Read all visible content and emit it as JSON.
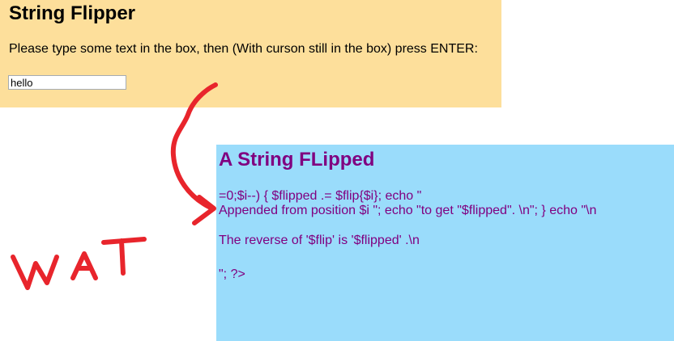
{
  "header": {
    "title": "String Flipper",
    "instructions": "Please type some text in the box, then (With curson still in the box) press ENTER:"
  },
  "input": {
    "value": "hello"
  },
  "result": {
    "title": "A String FLipped",
    "lines": [
      "=0;$i--) { $flipped .= $flip{$i}; echo \"",
      "Appended from position $i \"; echo \"to get \"$flipped\". \\n\"; } echo \"\\n",
      "The reverse of '$flip' is '$flipped' .\\n",
      "\"; ?>"
    ]
  },
  "annotation": {
    "text": "WAT",
    "color": "#e8252c"
  },
  "colors": {
    "top_panel_bg": "#fddf9b",
    "result_panel_bg": "#9adcfb",
    "result_text": "#800080"
  }
}
